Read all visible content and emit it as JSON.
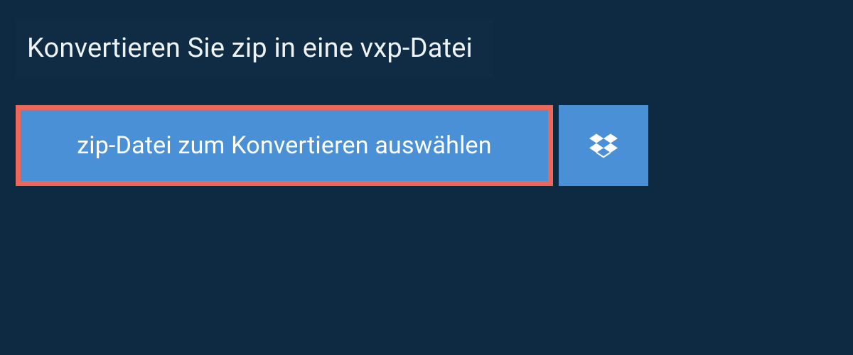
{
  "header": {
    "title": "Konvertieren Sie zip in eine vxp-Datei"
  },
  "actions": {
    "select_file_label": "zip-Datei zum Konvertieren auswählen"
  },
  "colors": {
    "page_bg": "#0d2a42",
    "panel_bg": "#102c44",
    "button_bg": "#4990d6",
    "highlight_border": "#eb6759",
    "text_light": "#ffffff"
  }
}
